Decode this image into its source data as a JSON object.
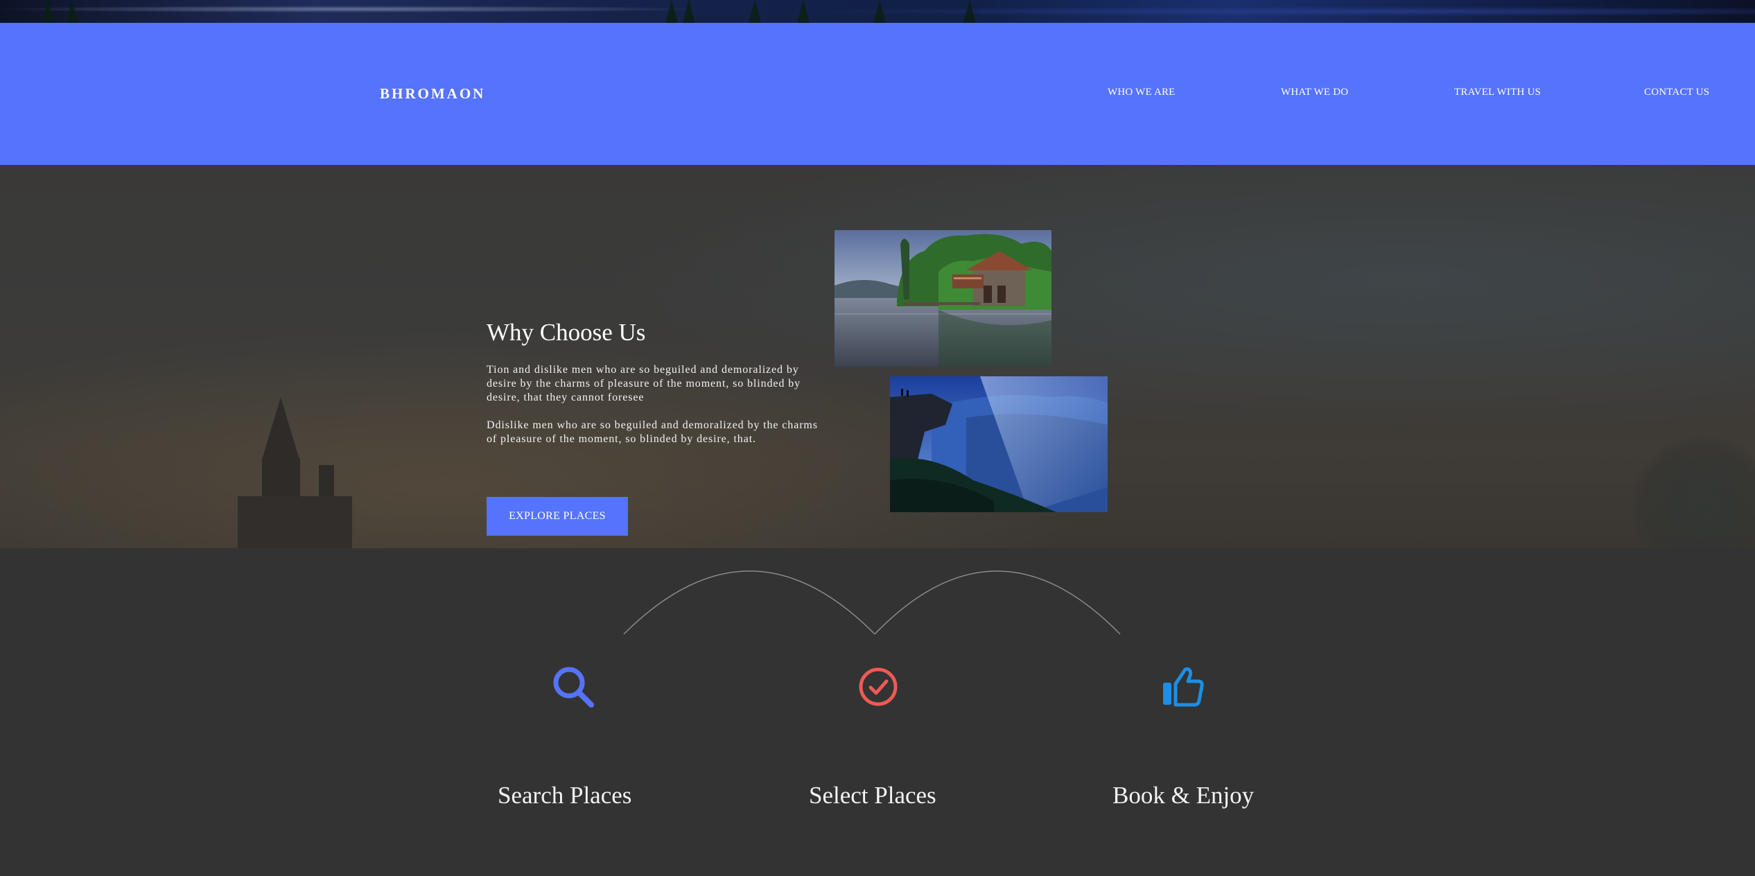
{
  "brand": {
    "name": "BHROMAON"
  },
  "nav": {
    "items": [
      {
        "label": "WHO WE ARE"
      },
      {
        "label": "WHAT WE DO"
      },
      {
        "label": "TRAVEL WITH US"
      },
      {
        "label": "CONTACT US"
      }
    ]
  },
  "hero": {
    "title": "Why Choose Us",
    "paragraph_1": "Tion and dislike men who are so beguiled and demoralized by desire by the charms of pleasure of the moment, so blinded by desire, that they cannot foresee",
    "paragraph_2": "Ddislike men who are so beguiled and demoralized by the charms of pleasure of the moment, so blinded by desire, that.",
    "cta_label": "EXPLORE PLACES",
    "images": [
      "lake-boathouse-photo",
      "mountain-canyon-photo"
    ]
  },
  "features": [
    {
      "icon": "search-icon",
      "title": "Search Places",
      "color": "#5573fd"
    },
    {
      "icon": "check-circle-icon",
      "title": "Select Places",
      "color": "#ee5a55"
    },
    {
      "icon": "thumbs-up-icon",
      "title": "Book & Enjoy",
      "color": "#1a8fe8"
    }
  ],
  "colors": {
    "accent": "#5573fd",
    "header_bg": "#5573fd",
    "page_bg": "#333333",
    "text": "#ffffff"
  }
}
